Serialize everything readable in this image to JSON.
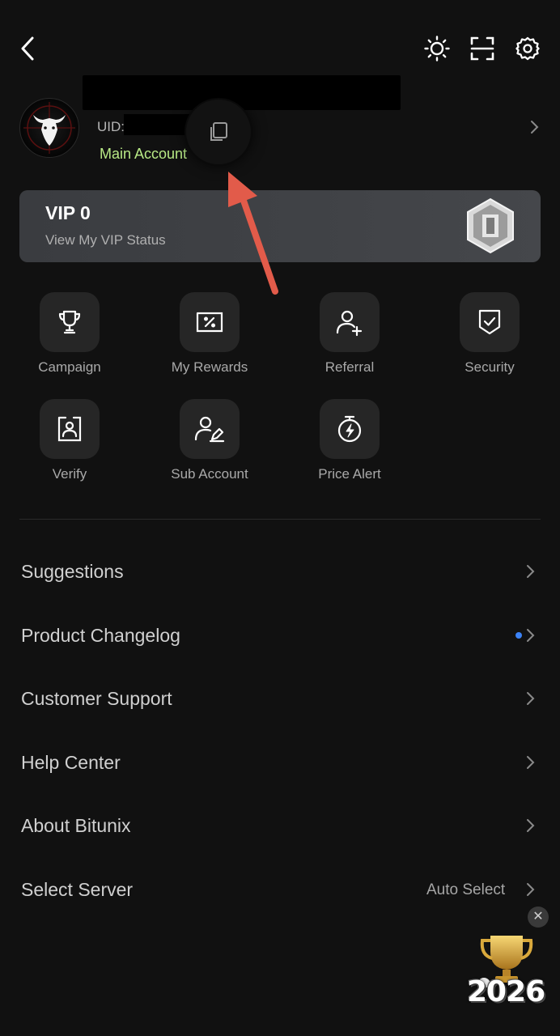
{
  "header": {
    "back_icon": "chevron-left-icon",
    "theme_icon": "sun-icon",
    "scan_icon": "scan-icon",
    "settings_icon": "gear-icon"
  },
  "profile": {
    "uid_label": "UID:",
    "account_type": "Main Account",
    "account_type_color": "#b8e986"
  },
  "vip": {
    "title": "VIP 0",
    "subtitle": "View My VIP Status"
  },
  "shortcuts": [
    {
      "label": "Campaign",
      "icon": "trophy-icon"
    },
    {
      "label": "My Rewards",
      "icon": "coupon-icon"
    },
    {
      "label": "Referral",
      "icon": "add-user-icon"
    },
    {
      "label": "Security",
      "icon": "shield-check-icon"
    },
    {
      "label": "Verify",
      "icon": "id-card-icon"
    },
    {
      "label": "Sub Account",
      "icon": "user-edit-icon"
    },
    {
      "label": "Price Alert",
      "icon": "stopwatch-icon"
    }
  ],
  "menu": [
    {
      "label": "Suggestions"
    },
    {
      "label": "Product Changelog",
      "has_new_dot": true,
      "dot_color": "#3b82f6"
    },
    {
      "label": "Customer Support"
    },
    {
      "label": "Help Center"
    },
    {
      "label": "About Bitunix"
    },
    {
      "label": "Select Server",
      "value": "Auto Select"
    }
  ],
  "promo": {
    "year": "2026",
    "close_label": "✕"
  }
}
